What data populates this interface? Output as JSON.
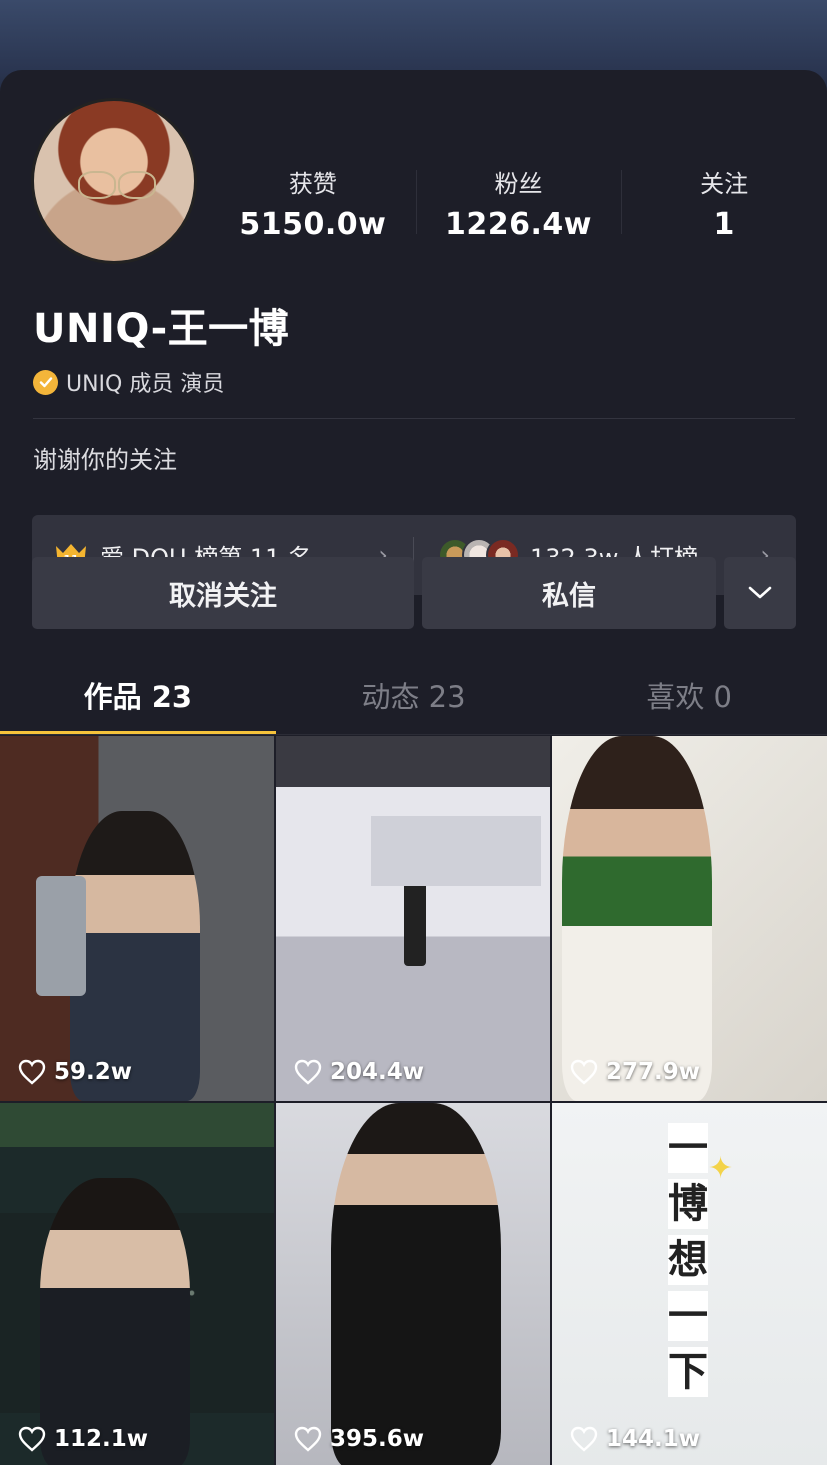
{
  "profile": {
    "name": "UNIQ-王一博",
    "verified_text": "UNIQ 成员 演员",
    "bio": "谢谢你的关注"
  },
  "stats": [
    {
      "label": "获赞",
      "value": "5150.0w"
    },
    {
      "label": "粉丝",
      "value": "1226.4w"
    },
    {
      "label": "关注",
      "value": "1"
    }
  ],
  "rank": {
    "badge_number": "11",
    "left_text": "爱 DOU 榜第 11 名",
    "right_text": "132.3w 人打榜"
  },
  "actions": {
    "unfollow_label": "取消关注",
    "message_label": "私信"
  },
  "tabs": [
    {
      "label": "作品 23",
      "active": true
    },
    {
      "label": "动态 23",
      "active": false
    },
    {
      "label": "喜欢 0",
      "active": false
    }
  ],
  "videos": [
    {
      "likes": "59.2w"
    },
    {
      "likes": "204.4w"
    },
    {
      "likes": "277.9w"
    },
    {
      "likes": "112.1w"
    },
    {
      "likes": "395.6w"
    },
    {
      "likes": "144.1w",
      "overlay_text": [
        "一",
        "博",
        "想",
        "一",
        "下"
      ]
    }
  ],
  "colors": {
    "accent": "#f5c33b",
    "background": "#1d1e28",
    "button": "#393a45",
    "verified": "#f3b53a"
  }
}
